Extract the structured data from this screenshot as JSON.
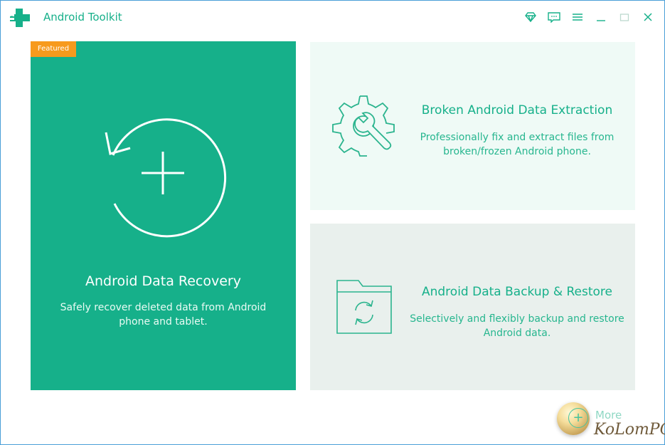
{
  "app": {
    "title": "Android Toolkit"
  },
  "window_controls": [
    {
      "icon": "diamond-icon"
    },
    {
      "icon": "feedback-icon"
    },
    {
      "icon": "menu-icon"
    },
    {
      "icon": "minimize-icon"
    },
    {
      "icon": "maximize-icon"
    },
    {
      "icon": "close-icon"
    }
  ],
  "cards": {
    "recovery": {
      "badge": "Featured",
      "title": "Android Data Recovery",
      "description": "Safely recover deleted data from Android phone and tablet.",
      "icon": "recovery-icon"
    },
    "extraction": {
      "title": "Broken Android Data Extraction",
      "description": "Professionally fix and extract files from broken/frozen Android phone.",
      "icon": "gear-wrench-icon"
    },
    "backup": {
      "title": "Android Data Backup & Restore",
      "description": "Selectively and flexibly backup and restore Android data.",
      "icon": "folder-sync-icon"
    }
  },
  "more": {
    "label": "More",
    "watermark": "KoLomPC"
  },
  "colors": {
    "accent": "#16b08a",
    "badge": "#f79a1d",
    "card_top_bg": "#effaf6",
    "card_bottom_bg": "#e9f0ed"
  }
}
